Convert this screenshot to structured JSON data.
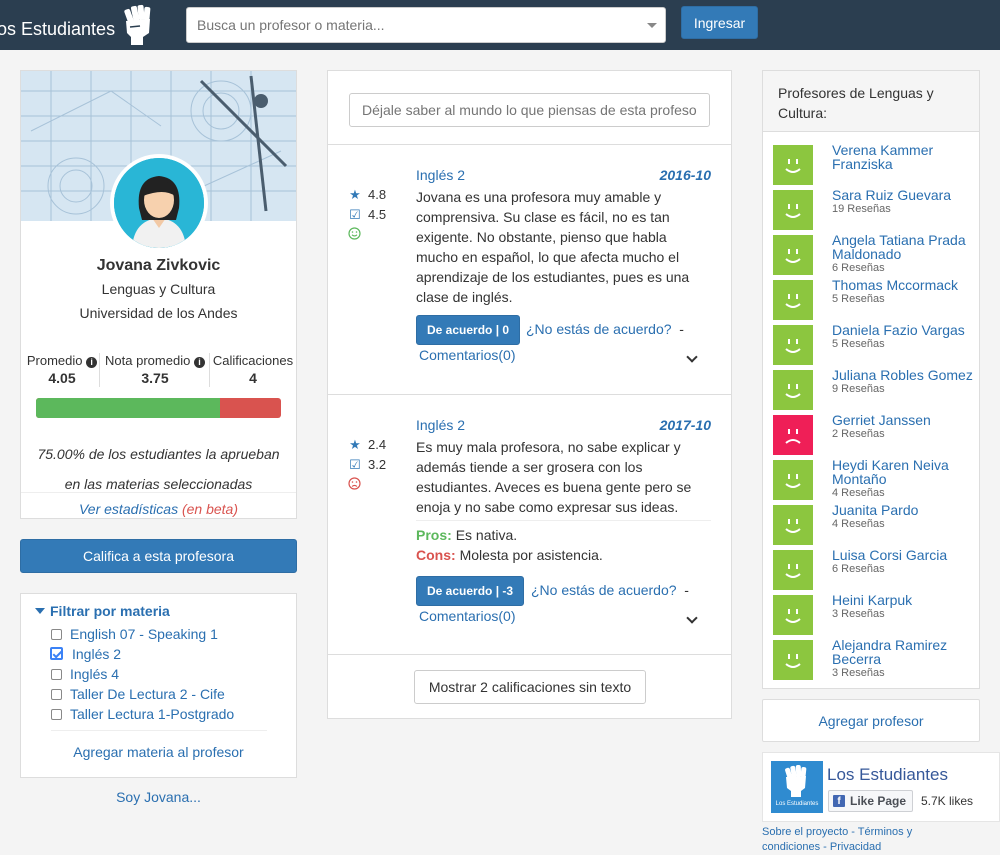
{
  "nav": {
    "brand": "os Estudiantes",
    "search_placeholder": "Busca un profesor o materia...",
    "login_label": "Ingresar"
  },
  "profile": {
    "name": "Jovana Zivkovic",
    "department": "Lenguas y Cultura",
    "university": "Universidad de los Andes",
    "stats": [
      {
        "label": "Promedio",
        "value": "4.05",
        "info": true
      },
      {
        "label": "Nota promedio",
        "value": "3.75",
        "info": true
      },
      {
        "label": "Calificaciones",
        "value": "4",
        "info": false
      }
    ],
    "approval_fraction": 0.75,
    "approval_line1": "75.00% de los estudiantes la aprueban",
    "approval_line2": "en las materias seleccionadas",
    "stats_link": "Ver estadísticas",
    "stats_beta": "(en beta)"
  },
  "rate_button": "Califica a esta profesora",
  "filter": {
    "title": "Filtrar por materia",
    "items": [
      {
        "label": "English 07 - Speaking 1",
        "checked": false
      },
      {
        "label": "Inglés 2",
        "checked": true
      },
      {
        "label": "Inglés 4",
        "checked": false
      },
      {
        "label": "Taller De Lectura 2 - Cife",
        "checked": false
      },
      {
        "label": "Taller Lectura 1-Postgrado",
        "checked": false
      }
    ],
    "add_subject": "Agregar materia al profesor"
  },
  "soy": "Soy Jovana...",
  "reviews": {
    "input_placeholder": "Déjale saber al mundo lo que piensas de esta profesora",
    "items": [
      {
        "course": "Inglés 2",
        "date": "2016-10",
        "rating": "4.8",
        "grade": "4.5",
        "mood": "happy",
        "text": "Jovana es una profesora muy amable y comprensiva. Su clase es fácil, no es tan exigente. No obstante, pienso que habla mucho en español, lo que afecta mucho el aprendizaje de los estudiantes, pues es una clase de inglés.",
        "agree_label": "De acuerdo | 0",
        "disagree_label": "¿No estás de acuerdo?",
        "comments_label": "Comentarios(0)"
      },
      {
        "course": "Inglés 2",
        "date": "2017-10",
        "rating": "2.4",
        "grade": "3.2",
        "mood": "sad",
        "text": "Es muy mala profesora, no sabe explicar y además tiende a ser grosera con los estudiantes. Aveces es buena gente pero se enoja y no sabe como expresar sus ideas.",
        "pros_label": "Pros:",
        "pros": "Es nativa.",
        "cons_label": "Cons:",
        "cons": "Molesta por asistencia.",
        "agree_label": "De acuerdo | -3",
        "disagree_label": "¿No estás de acuerdo?",
        "comments_label": "Comentarios(0)"
      }
    ],
    "more_button": "Mostrar 2 calificaciones sin texto"
  },
  "sidebar": {
    "title": "Profesores de Lenguas y Cultura:",
    "professors": [
      {
        "name": "Verena Kammer Franziska",
        "count": "",
        "mood": "happy"
      },
      {
        "name": "Sara Ruiz Guevara",
        "count": "19 Reseñas",
        "mood": "happy"
      },
      {
        "name": "Angela Tatiana Prada Maldonado",
        "count": "6 Reseñas",
        "mood": "happy"
      },
      {
        "name": "Thomas Mccormack",
        "count": "5 Reseñas",
        "mood": "happy"
      },
      {
        "name": "Daniela Fazio Vargas",
        "count": "5 Reseñas",
        "mood": "happy"
      },
      {
        "name": "Juliana Robles Gomez",
        "count": "9 Reseñas",
        "mood": "happy"
      },
      {
        "name": "Gerriet Janssen",
        "count": "2 Reseñas",
        "mood": "sad"
      },
      {
        "name": "Heydi Karen Neiva Montaño",
        "count": "4 Reseñas",
        "mood": "happy"
      },
      {
        "name": "Juanita Pardo",
        "count": "4 Reseñas",
        "mood": "happy"
      },
      {
        "name": "Luisa Corsi Garcia",
        "count": "6 Reseñas",
        "mood": "happy"
      },
      {
        "name": "Heini Karpuk",
        "count": "3 Reseñas",
        "mood": "happy"
      },
      {
        "name": "Alejandra Ramirez Becerra",
        "count": "3 Reseñas",
        "mood": "happy"
      }
    ],
    "add_professor": "Agregar profesor",
    "fb": {
      "name": "Los Estudiantes",
      "like_label": "Like Page",
      "likes": "5.7K likes",
      "logo_text": "Los Estudiantes"
    },
    "footer": {
      "about": "Sobre el proyecto",
      "sep": " - ",
      "terms": "Términos y condiciones",
      "privacy": "Privacidad"
    }
  },
  "colors": {
    "navbar": "#2b3e50",
    "primary": "#337ab7",
    "happy": "#8cc63f",
    "sad": "#ef1f57",
    "approve": "#5cb85c",
    "disapprove": "#d9534f"
  }
}
